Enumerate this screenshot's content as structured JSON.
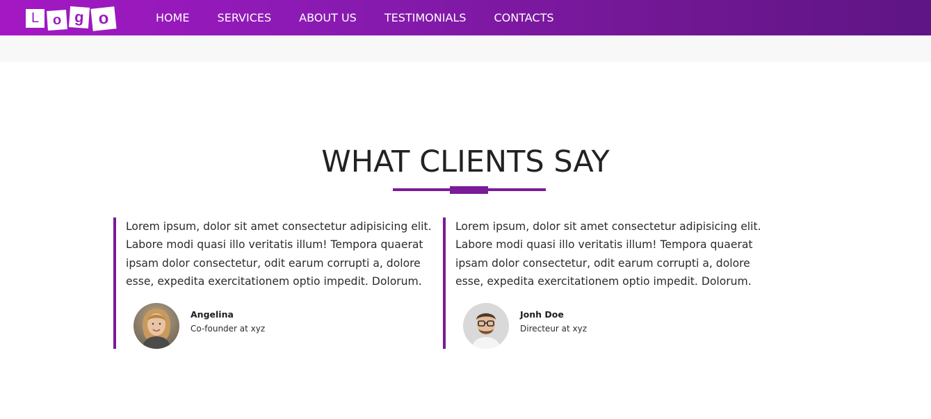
{
  "brand": {
    "logo_letters": [
      "L",
      "o",
      "g",
      "o"
    ],
    "accent_color": "#7a1b98",
    "nav_gradient_start": "#a418c4",
    "nav_gradient_end": "#5e1585"
  },
  "nav": {
    "items": [
      {
        "label": "HOME"
      },
      {
        "label": "SERVICES"
      },
      {
        "label": "ABOUT US"
      },
      {
        "label": "TESTIMONIALS"
      },
      {
        "label": "CONTACTS"
      }
    ]
  },
  "section": {
    "title": "WHAT CLIENTS SAY"
  },
  "testimonials": [
    {
      "quote": "Lorem ipsum, dolor sit amet consectetur adipisicing elit. Labore modi quasi illo veritatis illum! Tempora quaerat ipsam dolor consectetur, odit earum corrupti a, dolore esse, expedita exercitationem optio impedit. Dolorum.",
      "name": "Angelina",
      "role": "Co-founder at xyz",
      "avatar_icon": "woman-portrait-avatar"
    },
    {
      "quote": "Lorem ipsum, dolor sit amet consectetur adipisicing elit. Labore modi quasi illo veritatis illum! Tempora quaerat ipsam dolor consectetur, odit earum corrupti a, dolore esse, expedita exercitationem optio impedit. Dolorum.",
      "name": "Jonh Doe",
      "role": "Directeur at xyz",
      "avatar_icon": "man-portrait-avatar"
    }
  ]
}
